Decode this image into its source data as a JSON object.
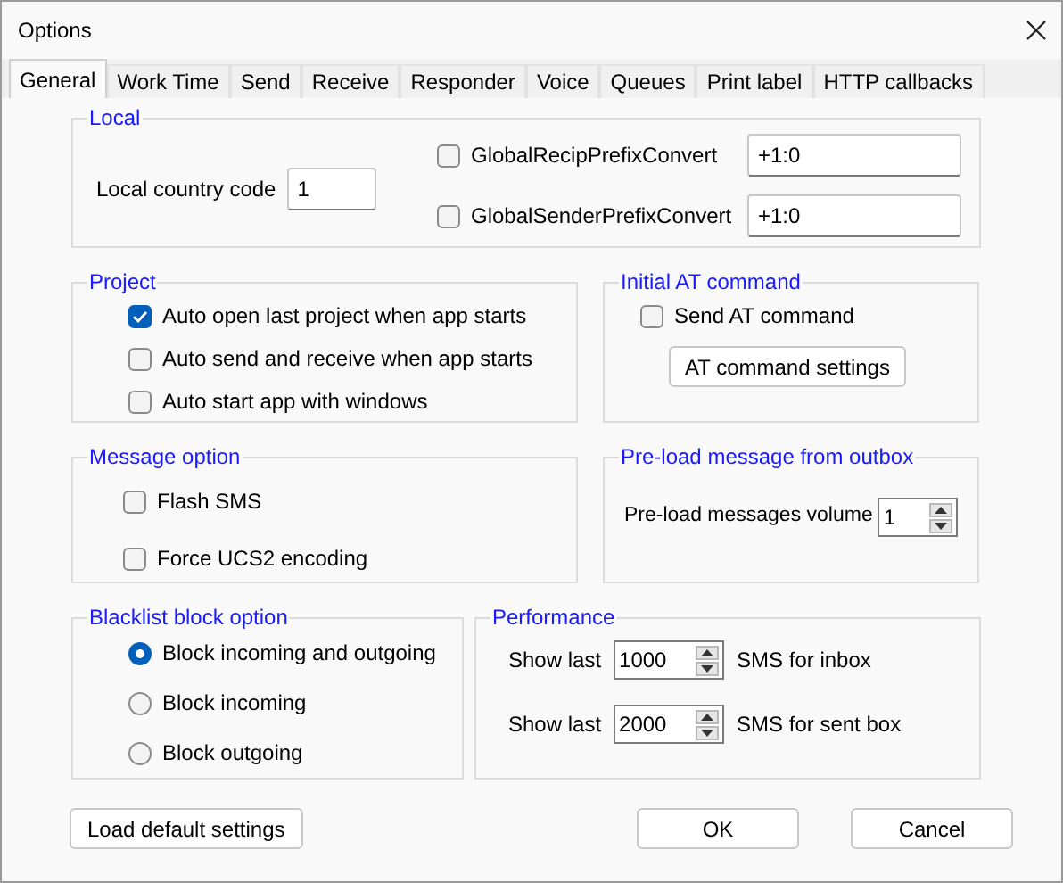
{
  "window": {
    "title": "Options"
  },
  "tabs": [
    {
      "label": "General",
      "selected": true
    },
    {
      "label": "Work Time",
      "selected": false
    },
    {
      "label": "Send",
      "selected": false
    },
    {
      "label": "Receive",
      "selected": false
    },
    {
      "label": "Responder",
      "selected": false
    },
    {
      "label": "Voice",
      "selected": false
    },
    {
      "label": "Queues",
      "selected": false
    },
    {
      "label": "Print label",
      "selected": false
    },
    {
      "label": "HTTP callbacks",
      "selected": false
    }
  ],
  "local": {
    "title": "Local",
    "country_code_label": "Local country code",
    "country_code": "1",
    "prefixes": [
      {
        "label": "GlobalRecipPrefixConvert",
        "checked": false,
        "value": "+1:0"
      },
      {
        "label": "GlobalSenderPrefixConvert",
        "checked": false,
        "value": "+1:0"
      }
    ]
  },
  "project": {
    "title": "Project",
    "options": [
      {
        "label": "Auto open last project when app starts",
        "checked": true
      },
      {
        "label": "Auto send and receive when app starts",
        "checked": false
      },
      {
        "label": "Auto start app with windows",
        "checked": false
      }
    ]
  },
  "initial_at": {
    "title": "Initial AT command",
    "option": {
      "label": "Send AT command",
      "checked": false
    },
    "button": "AT command settings"
  },
  "message_option": {
    "title": "Message option",
    "options": [
      {
        "label": "Flash SMS",
        "checked": false
      },
      {
        "label": "Force UCS2 encoding",
        "checked": false
      }
    ]
  },
  "preload": {
    "title": "Pre-load message from outbox",
    "label": "Pre-load messages volume",
    "value": "1"
  },
  "blacklist": {
    "title": "Blacklist block option",
    "options": [
      {
        "label": "Block incoming and outgoing",
        "selected": true
      },
      {
        "label": "Block incoming",
        "selected": false
      },
      {
        "label": "Block outgoing",
        "selected": false
      }
    ]
  },
  "performance": {
    "title": "Performance",
    "rows": [
      {
        "prefix": "Show last",
        "value": "1000",
        "suffix": "SMS for inbox"
      },
      {
        "prefix": "Show last",
        "value": "2000",
        "suffix": "SMS for sent box"
      }
    ]
  },
  "buttons": {
    "load_default": "Load default settings",
    "ok": "OK",
    "cancel": "Cancel"
  }
}
